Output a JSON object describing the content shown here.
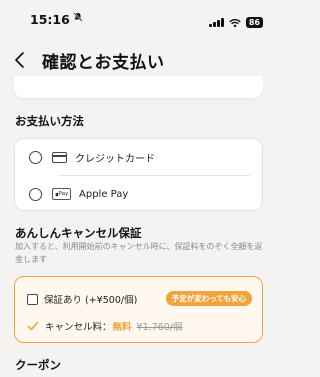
{
  "status_bar": {
    "time": "15:16",
    "battery": "86"
  },
  "header": {
    "title": "確認とお支払い"
  },
  "payment": {
    "section_title": "お支払い方法",
    "options": [
      {
        "label": "クレジットカード",
        "icon": "credit-card-icon"
      },
      {
        "label": "Apple Pay",
        "icon": "apple-pay-icon",
        "icon_text": "Pay"
      }
    ]
  },
  "insurance": {
    "section_title": "あんしんキャンセル保証",
    "description": "加入すると、利用開始前のキャンセル時に、保証料をのぞく全額を返金します",
    "option_label": "保証あり (+¥500/個)",
    "badge": "予定が変わっても安心",
    "fee_label": "キャンセル料：",
    "fee_free": "無料",
    "fee_old": "¥1,760/個",
    "accent_color": "#f2a43c"
  },
  "coupon": {
    "section_title": "クーポン"
  }
}
